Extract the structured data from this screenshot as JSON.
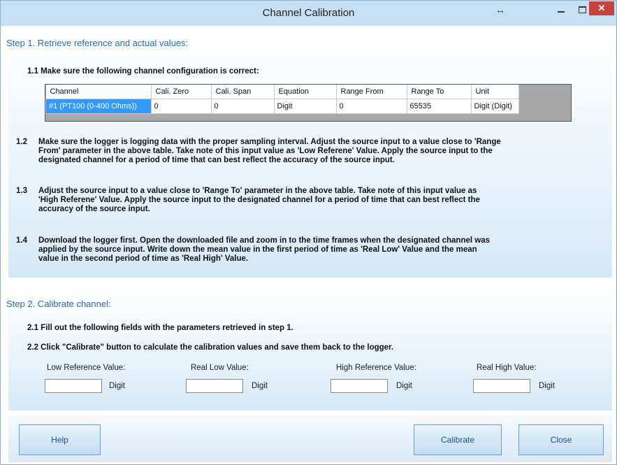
{
  "window": {
    "title": "Channel Calibration",
    "resize_glyph": "↔",
    "close_glyph": "✕"
  },
  "step1": {
    "title": "Step 1. Retrieve reference and actual values:",
    "item1_1": "1.1 Make sure the following channel configuration is correct:",
    "table": {
      "headers": [
        "Channel",
        "Cali. Zero",
        "Cali. Span",
        "Equation",
        "Range From",
        "Range To",
        "Unit"
      ],
      "row": [
        "#1 (PT100 (0-400 Ohms))",
        "0",
        "0",
        "Digit",
        "0",
        "65535",
        "Digit (Digit)"
      ]
    },
    "item1_2": {
      "num": "1.2",
      "lines": [
        "Make sure the logger is logging data with the proper sampling interval. Adjust the source input to a value close to 'Range",
        "From' parameter in the above table.  Take note of this input value as 'Low Referene' Value. Apply the source input to the",
        "designated channel for a period of time that can best reflect the accuracy of the source input."
      ]
    },
    "item1_3": {
      "num": "1.3",
      "lines": [
        "Adjust the source input to a value close to 'Range To' parameter in the above table. Take note of this input value as",
        "'High Referene' Value. Apply the source input to the designated channel for a period of time that can best reflect the",
        "accuracy of the source input."
      ]
    },
    "item1_4": {
      "num": "1.4",
      "lines": [
        "Download the logger first. Open the downloaded file and zoom in to the time frames when the designated channel was",
        "applied by the source input. Write down the mean value in the first period of time as 'Real Low' Value and the mean",
        "value in the second period of time as 'Real High' Value."
      ]
    }
  },
  "step2": {
    "title": "Step 2. Calibrate channel:",
    "item2_1": "2.1 Fill out the following fields with the parameters retrieved in step 1.",
    "item2_2": "2.2 Click \"Calibrate\" button to calculate the calibration values and save them back to the logger.",
    "fields": [
      {
        "label": "Low Reference Value:",
        "value": "",
        "unit": "Digit"
      },
      {
        "label": "Real Low Value:",
        "value": "",
        "unit": "Digit"
      },
      {
        "label": "High Reference Value:",
        "value": "",
        "unit": "Digit"
      },
      {
        "label": "Real High Value:",
        "value": "",
        "unit": "Digit"
      }
    ]
  },
  "buttons": {
    "help": "Help",
    "calibrate": "Calibrate",
    "close": "Close"
  }
}
